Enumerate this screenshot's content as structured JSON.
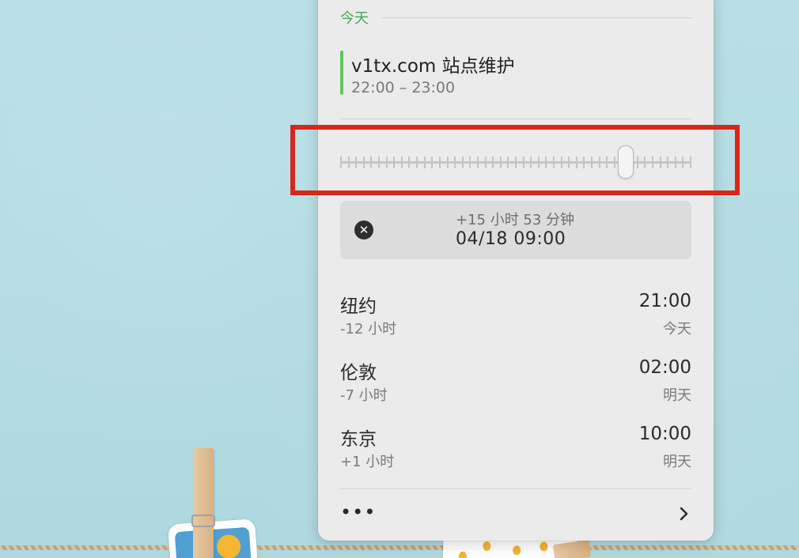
{
  "panel": {
    "section_label": "今天",
    "event": {
      "title": "v1tx.com 站点维护",
      "time": "22:00 – 23:00",
      "color": "#5bc85a"
    },
    "slider": {
      "value": 0.81
    },
    "offset": {
      "delta": "+15 小时 53 分钟",
      "datetime": "04/18 09:00"
    },
    "cities": [
      {
        "name": "纽约",
        "offset": "-12 小时",
        "time": "21:00",
        "day": "今天"
      },
      {
        "name": "伦敦",
        "offset": "-7 小时",
        "time": "02:00",
        "day": "明天"
      },
      {
        "name": "东京",
        "offset": "+1 小时",
        "time": "10:00",
        "day": "明天"
      }
    ],
    "footer": {
      "more_label": "•••",
      "chevron_icon": "chevron-right-icon"
    }
  },
  "highlight_color": "#d9261c"
}
